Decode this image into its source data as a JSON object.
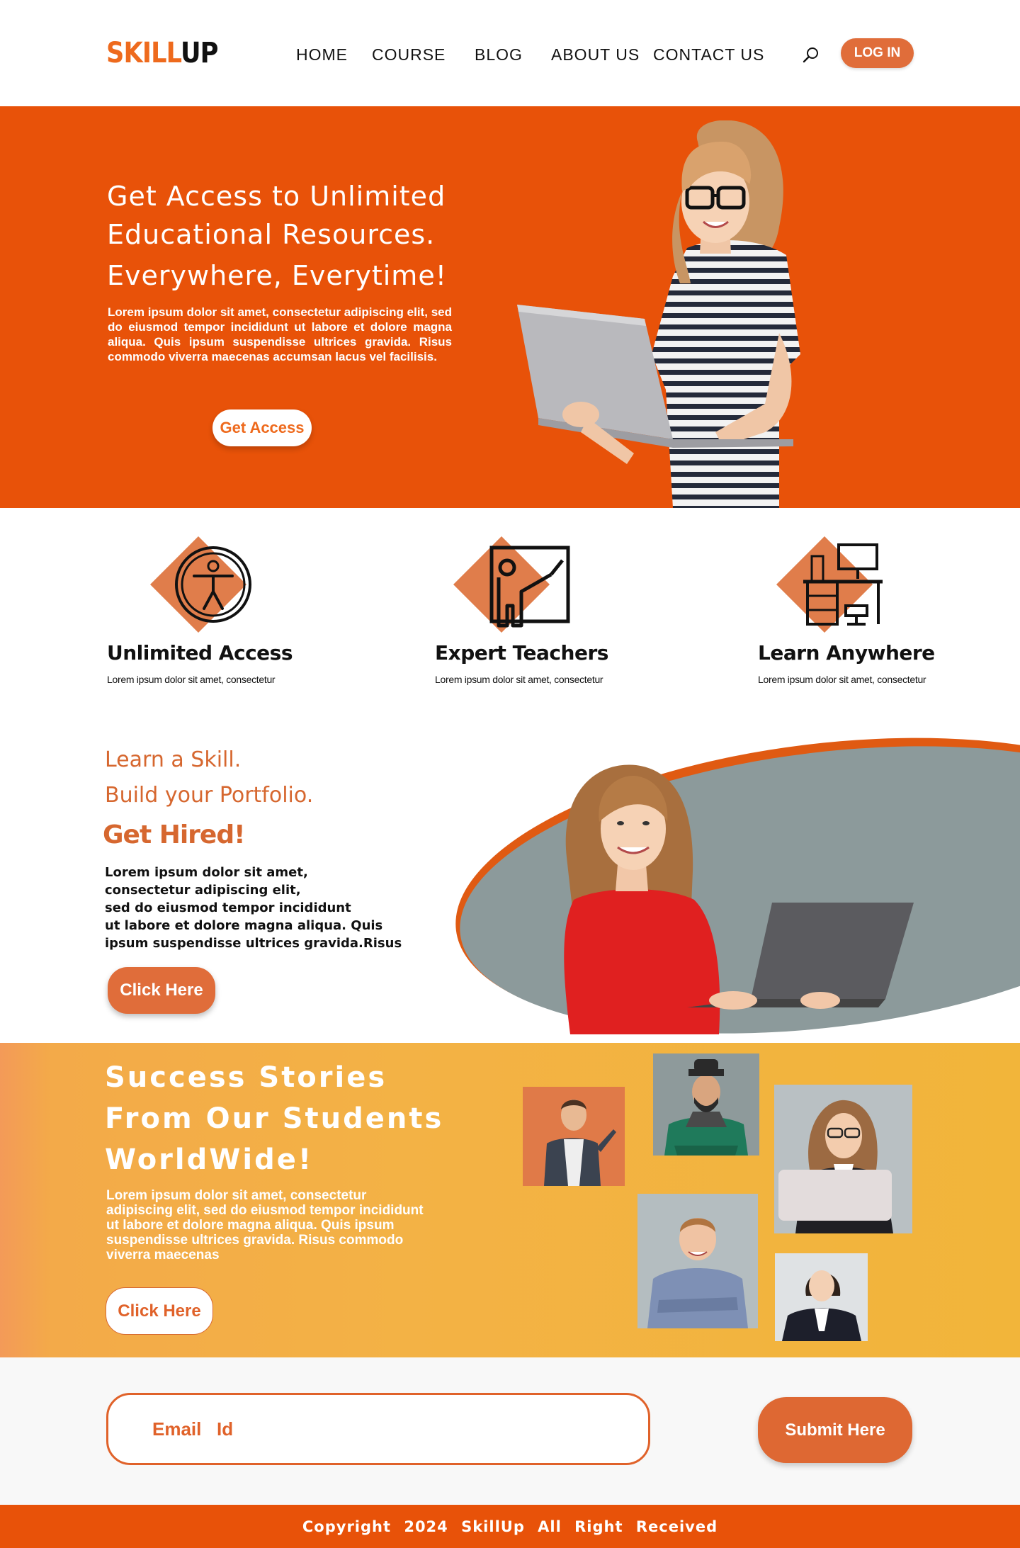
{
  "brand": {
    "logo_part1": "SKILL",
    "logo_part2": "UP"
  },
  "nav": {
    "items": [
      {
        "label": "HOME"
      },
      {
        "label": "COURSE"
      },
      {
        "label": "BLOG"
      },
      {
        "label": "ABOUT US"
      },
      {
        "label": "CONTACT US"
      }
    ],
    "search_icon": "search-icon",
    "login_label": "LOG IN"
  },
  "hero": {
    "title_line1": "Get Access to Unlimited",
    "title_line2": "Educational Resources.",
    "title_line3": "Everywhere, Everytime!",
    "text": "Lorem ipsum dolor sit amet, consectetur adipiscing elit, sed do eiusmod tempor incididunt ut labore et dolore magna aliqua. Quis ipsum suspendisse ultrices gravida. Risus commodo viverra maecenas accumsan lacus vel facilisis.",
    "cta_label": "Get Access"
  },
  "features": [
    {
      "title": "Unlimited Access",
      "desc": "Lorem ipsum dolor sit amet, consectetur",
      "icon": "accessibility-icon"
    },
    {
      "title": "Expert Teachers",
      "desc": "Lorem ipsum dolor sit amet, consectetur",
      "icon": "teacher-board-icon"
    },
    {
      "title": "Learn Anywhere",
      "desc": "Lorem ipsum dolor sit amet, consectetur",
      "icon": "desk-workspace-icon"
    }
  ],
  "learn": {
    "line1": "Learn a Skill.",
    "line2": "Build your Portfolio.",
    "line3": "Get Hired!",
    "text_lines": [
      "Lorem ipsum dolor sit amet,",
      "consectetur adipiscing elit,",
      "sed do eiusmod tempor incididunt",
      "ut labore et dolore magna aliqua. Quis",
      "ipsum suspendisse ultrices gravida.Risus"
    ],
    "cta_label": "Click Here"
  },
  "success": {
    "title_line1": "Success Stories",
    "title_line2": "From Our Students",
    "title_line3": "WorldWide!",
    "text": "Lorem ipsum dolor sit amet, consectetur adipiscing elit, sed do eiusmod tempor incididunt ut labore et dolore magna aliqua. Quis ipsum suspendisse ultrices gravida. Risus commodo viverra maecenas",
    "cta_label": "Click Here"
  },
  "signup": {
    "email_placeholder": "Email   Id",
    "submit_label": "Submit Here"
  },
  "footer": {
    "text": "Copyright  2024  SkillUp  All Right Received"
  },
  "colors": {
    "brand_orange": "#e85209",
    "button_orange": "#e06d3a",
    "text_orange": "#d6672f",
    "gold": "#f2b53a"
  }
}
